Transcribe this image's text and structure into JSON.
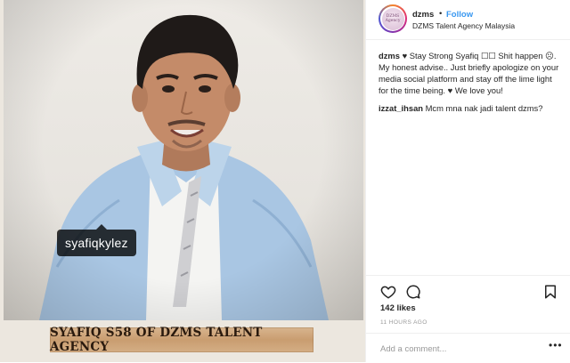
{
  "media": {
    "user_tag": "syafiqkylez",
    "banner_text": "SYAFIQ S58 OF DZMS TALENT AGENCY"
  },
  "header": {
    "avatar_text": "DZMS Agency",
    "username": "dzms",
    "separator": "•",
    "follow_label": "Follow",
    "location": "DZMS Talent Agency Malaysia"
  },
  "comments": [
    {
      "user": "dzms",
      "text": "♥ Stay Strong Syafiq ☐☐ Shit happen ☹. My honest advise.. Just briefly apologize on your media social platform and stay off the lime light for the time being. ♥ We love you!"
    },
    {
      "user": "izzat_ihsan",
      "text": "Mcm mna nak jadi talent dzms?"
    }
  ],
  "actions": {
    "like_icon": "heart-icon",
    "comment_icon": "comment-icon",
    "save_icon": "bookmark-icon",
    "likes": "142 likes",
    "time": "11 HOURS AGO"
  },
  "add_comment": {
    "placeholder": "Add a comment...",
    "more_icon": "more-icon",
    "more_glyph": "•••"
  },
  "colors": {
    "link": "#3897f0",
    "text": "#262626",
    "muted": "#999999",
    "banner": "#c99d70"
  }
}
